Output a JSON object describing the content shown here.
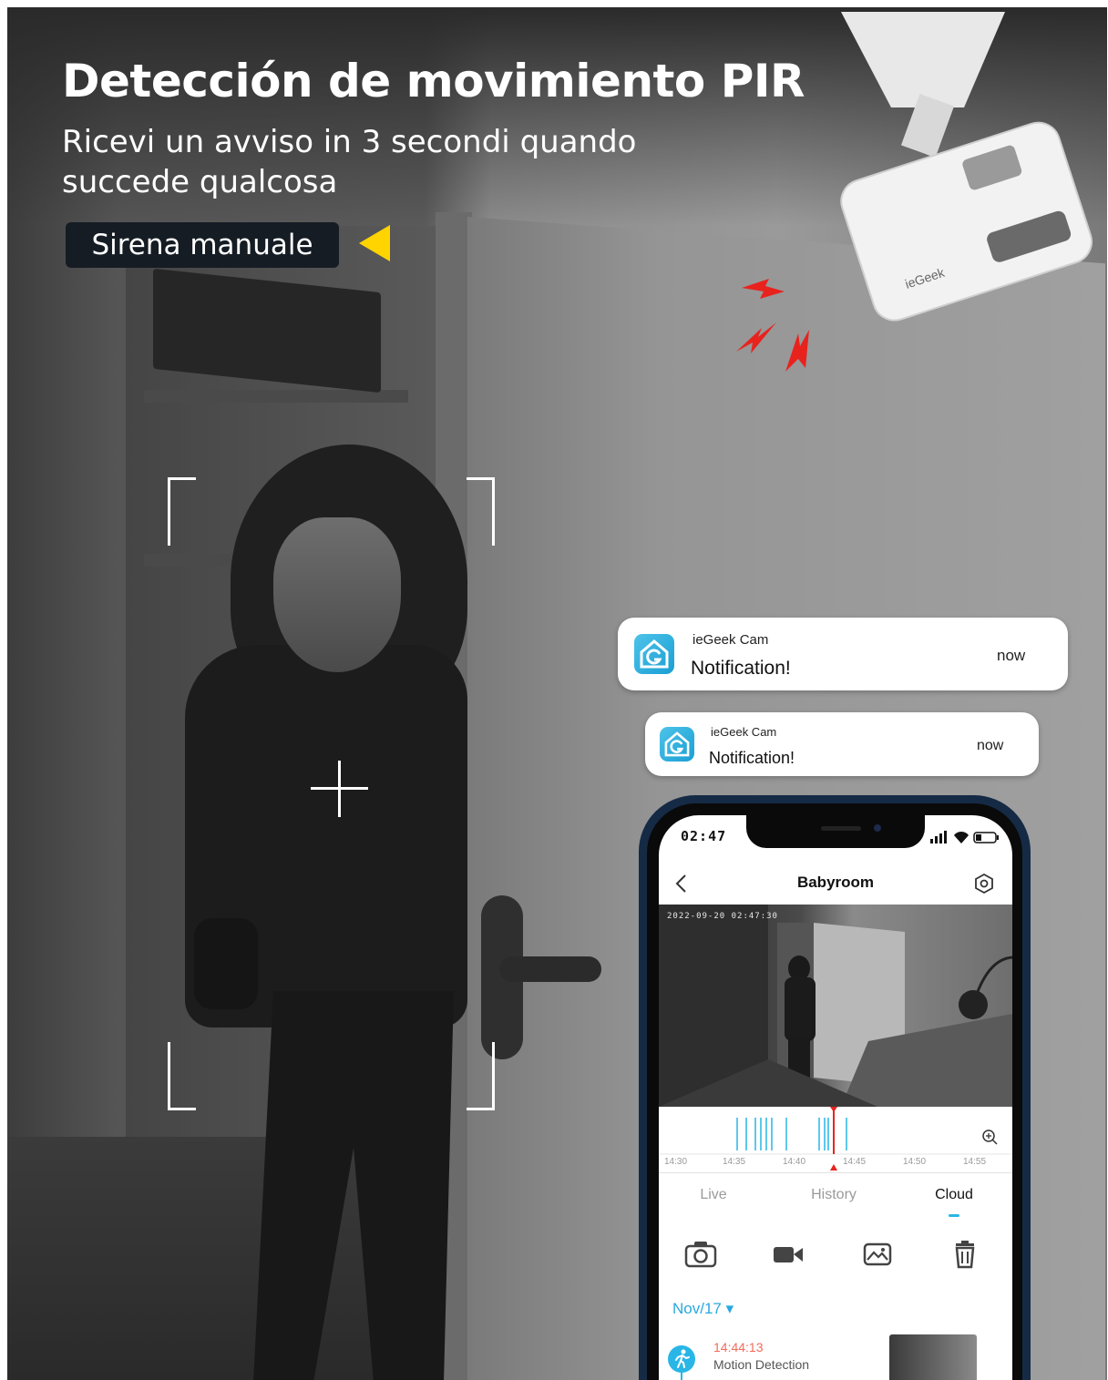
{
  "hero": {
    "title": "Detección de movimiento PIR",
    "subtitle": "Ricevi un avviso in 3 secondi quando succede qualcosa",
    "siren_label": "Sirena manuale",
    "accent_color": "#ffd400",
    "alert_color": "#e8231e"
  },
  "notifications": [
    {
      "app": "ieGeek Cam",
      "message": "Notification!",
      "time": "now"
    },
    {
      "app": "ieGeek Cam",
      "message": "Notification!",
      "time": "now"
    }
  ],
  "phone": {
    "status_time": "02:47",
    "nav": {
      "title": "Babyroom",
      "back_icon": "chevron-left-icon",
      "settings_icon": "hexagon-gear-icon"
    },
    "video": {
      "timestamp": "2022-09-20 02:47:30"
    },
    "timeline": {
      "ticks": [
        "14:30",
        "14:35",
        "14:40",
        "14:45",
        "14:50",
        "14:55"
      ],
      "zoom_icon": "zoom-in-icon"
    },
    "tabs": [
      {
        "label": "Live",
        "active": false
      },
      {
        "label": "History",
        "active": false
      },
      {
        "label": "Cloud",
        "active": true
      }
    ],
    "toolbar": [
      "camera-icon",
      "video-camera-icon",
      "image-icon",
      "trash-icon"
    ],
    "date_filter": "Nov/17 ▾",
    "events": [
      {
        "time": "14:44:13",
        "label": "Motion Detection",
        "icon": "running-person-icon"
      }
    ],
    "accent_color": "#29b6e6"
  },
  "camera_brand": "ieGeek"
}
